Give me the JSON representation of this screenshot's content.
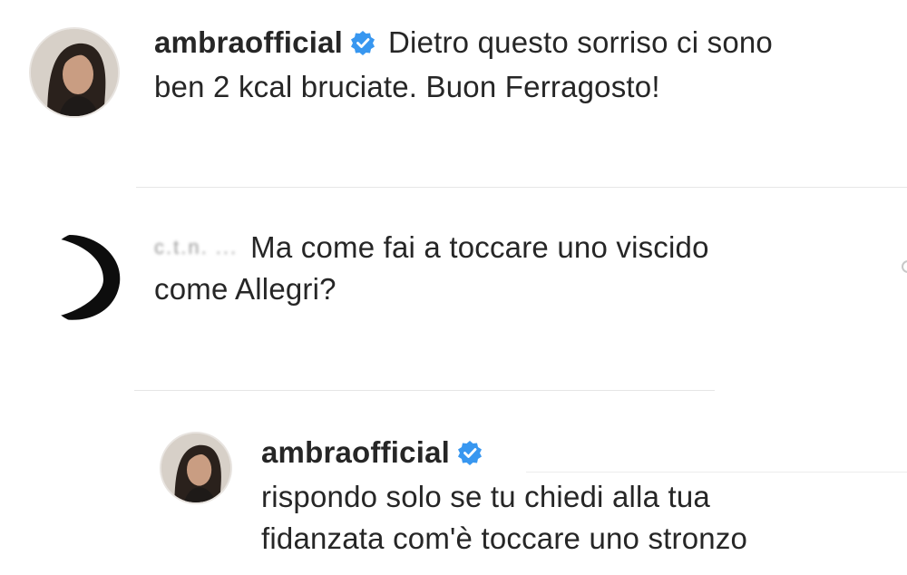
{
  "post": {
    "username": "ambraofficial",
    "caption_line1": "Dietro questo sorriso ci sono",
    "caption_line2": "ben 2 kcal bruciate. Buon Ferragosto!"
  },
  "comment": {
    "username_blurred": "c.t.n.  ...",
    "text_line1": "Ma come fai a toccare uno viscido",
    "text_line2": "come Allegri?"
  },
  "reply": {
    "username": "ambraofficial",
    "text_line1": "rispondo solo se tu chiedi alla tua",
    "text_line2": "fidanzata com'è toccare uno stronzo"
  },
  "colors": {
    "verified_badge": "#3897f0",
    "text": "#262626",
    "divider": "#e6e6e6"
  },
  "icons": {
    "verified": "verified-badge-icon",
    "avatar": "profile-photo"
  }
}
